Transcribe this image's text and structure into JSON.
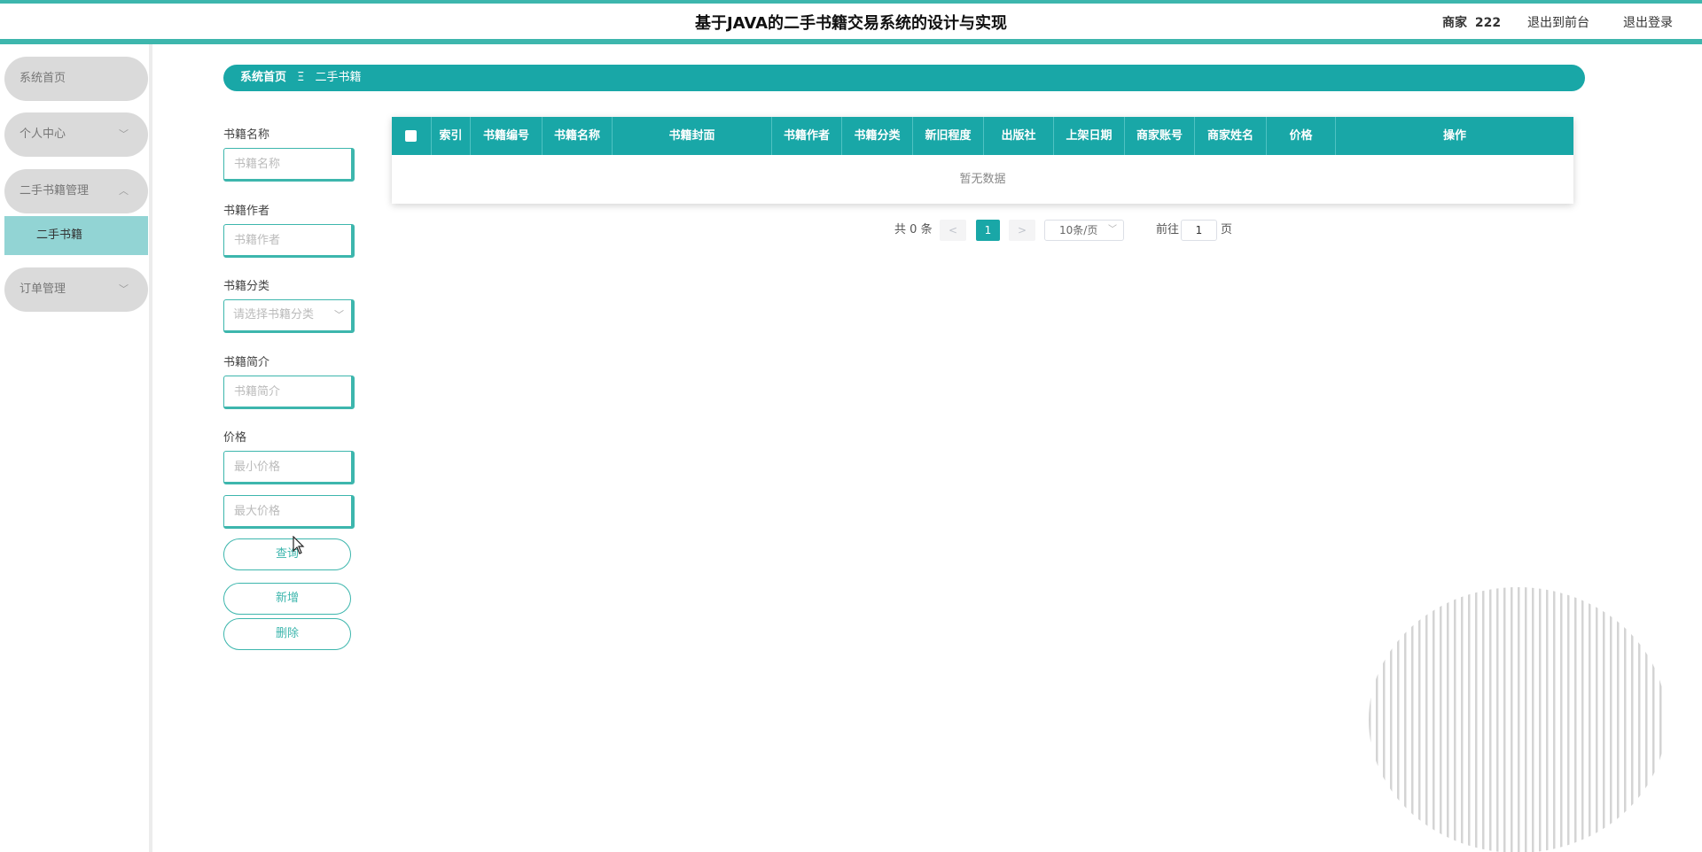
{
  "header": {
    "title": "基于JAVA的二手书籍交易系统的设计与实现",
    "user_role": "商家",
    "user_name": "222",
    "front_link": "退出到前台",
    "logout_link": "退出登录"
  },
  "sidebar": {
    "items": [
      {
        "label": "系统首页"
      },
      {
        "label": "个人中心"
      },
      {
        "label": "二手书籍管理"
      },
      {
        "label": "订单管理"
      }
    ],
    "sub_item": "二手书籍"
  },
  "breadcrumb": {
    "home": "系统首页",
    "separator": "Ξ",
    "current": "二手书籍"
  },
  "search": {
    "name_label": "书籍名称",
    "name_placeholder": "书籍名称",
    "author_label": "书籍作者",
    "author_placeholder": "书籍作者",
    "category_label": "书籍分类",
    "category_placeholder": "请选择书籍分类",
    "intro_label": "书籍简介",
    "intro_placeholder": "书籍简介",
    "price_label": "价格",
    "min_price_placeholder": "最小价格",
    "max_price_placeholder": "最大价格",
    "query_button": "查询",
    "add_button": "新增",
    "delete_button": "删除"
  },
  "table": {
    "columns": [
      "索引",
      "书籍编号",
      "书籍名称",
      "书籍封面",
      "书籍作者",
      "书籍分类",
      "新旧程度",
      "出版社",
      "上架日期",
      "商家账号",
      "商家姓名",
      "价格",
      "操作"
    ],
    "empty_text": "暂无数据"
  },
  "pagination": {
    "total_prefix": "共",
    "total": "0",
    "total_suffix": "条",
    "prev": "<",
    "current_page": "1",
    "next": ">",
    "page_size": "10条/页",
    "goto_prefix": "前往",
    "goto_value": "1",
    "goto_suffix": "页"
  },
  "colors": {
    "accent": "#19a7a7",
    "header_border": "#3db6ad",
    "submenu_active": "#92d4d4",
    "menu_bg": "#dadada"
  }
}
